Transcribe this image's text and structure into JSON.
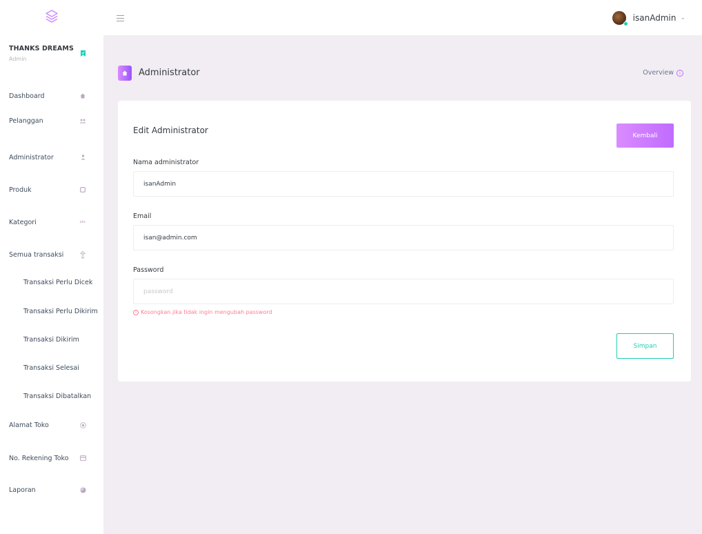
{
  "topbar": {
    "brand_icon": "layers-logo-icon",
    "menu_icon": "hamburger-icon",
    "user": {
      "name": "isanAdmin",
      "status_color": "#1bcfb4"
    }
  },
  "sidebar": {
    "profile": {
      "name": "THANKS DREAMS",
      "role": "Admin",
      "badge_color": "#1bcfb4"
    },
    "items": [
      {
        "label": "Dashboard",
        "icon": "home-icon"
      },
      {
        "label": "Pelanggan",
        "icon": "users-icon"
      },
      {
        "label": "Administrator",
        "icon": "user-icon"
      },
      {
        "label": "Produk",
        "icon": "box-icon"
      },
      {
        "label": "Kategori",
        "icon": "abc-icon"
      },
      {
        "label": "Semua transaksi",
        "icon": "transfer-icon"
      }
    ],
    "sub_items": [
      {
        "label": "Transaksi Perlu Dicek"
      },
      {
        "label": "Transaksi Perlu Dikirim"
      },
      {
        "label": "Transaksi Dikirim"
      },
      {
        "label": "Transaksi Selesai"
      },
      {
        "label": "Transaksi Dibatalkan"
      }
    ],
    "bottom_items": [
      {
        "label": "Alamat Toko",
        "icon": "target-icon"
      },
      {
        "label": "No. Rekening Toko",
        "icon": "card-icon"
      },
      {
        "label": "Laporan",
        "icon": "chart-icon"
      }
    ]
  },
  "page_header": {
    "title": "Administrator",
    "overview_label": "Overview"
  },
  "form": {
    "title": "Edit Administrator",
    "back_label": "Kembali",
    "name_label": "Nama administrator",
    "name_value": "isanAdmin",
    "email_label": "Email",
    "email_value": "isan@admin.com",
    "password_label": "Password",
    "password_value": "",
    "password_placeholder": "password",
    "password_hint": "Kosongkan jika tidak ingin mengubah password",
    "save_label": "Simpan"
  },
  "colors": {
    "accent_gradient_start": "#da8cff",
    "accent_gradient_end": "#9a55ff",
    "success": "#1bcfb4",
    "danger": "#fe7c96",
    "page_bg": "#f2edf3"
  }
}
